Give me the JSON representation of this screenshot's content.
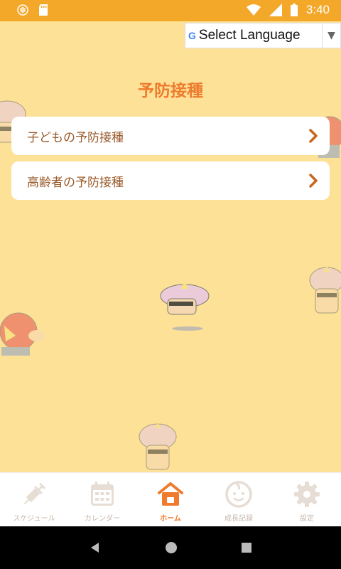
{
  "status_bar": {
    "time": "3:40"
  },
  "language": {
    "label": "Select Language",
    "google_letter": "G"
  },
  "page": {
    "title": "予防接種"
  },
  "menu": [
    {
      "label": "子どもの予防接種"
    },
    {
      "label": "高齢者の予防接種"
    }
  ],
  "tabs": [
    {
      "label": "スケジュール",
      "icon": "syringe-icon"
    },
    {
      "label": "カレンダー",
      "icon": "calendar-icon"
    },
    {
      "label": "ホーム",
      "icon": "home-icon",
      "active": true
    },
    {
      "label": "成長記録",
      "icon": "baby-face-icon"
    },
    {
      "label": "設定",
      "icon": "gear-icon"
    }
  ],
  "colors": {
    "accent": "#ee7b2e",
    "status_bar": "#f3a82a",
    "background": "#fde196",
    "inactive_tab": "#c8b8ac"
  }
}
